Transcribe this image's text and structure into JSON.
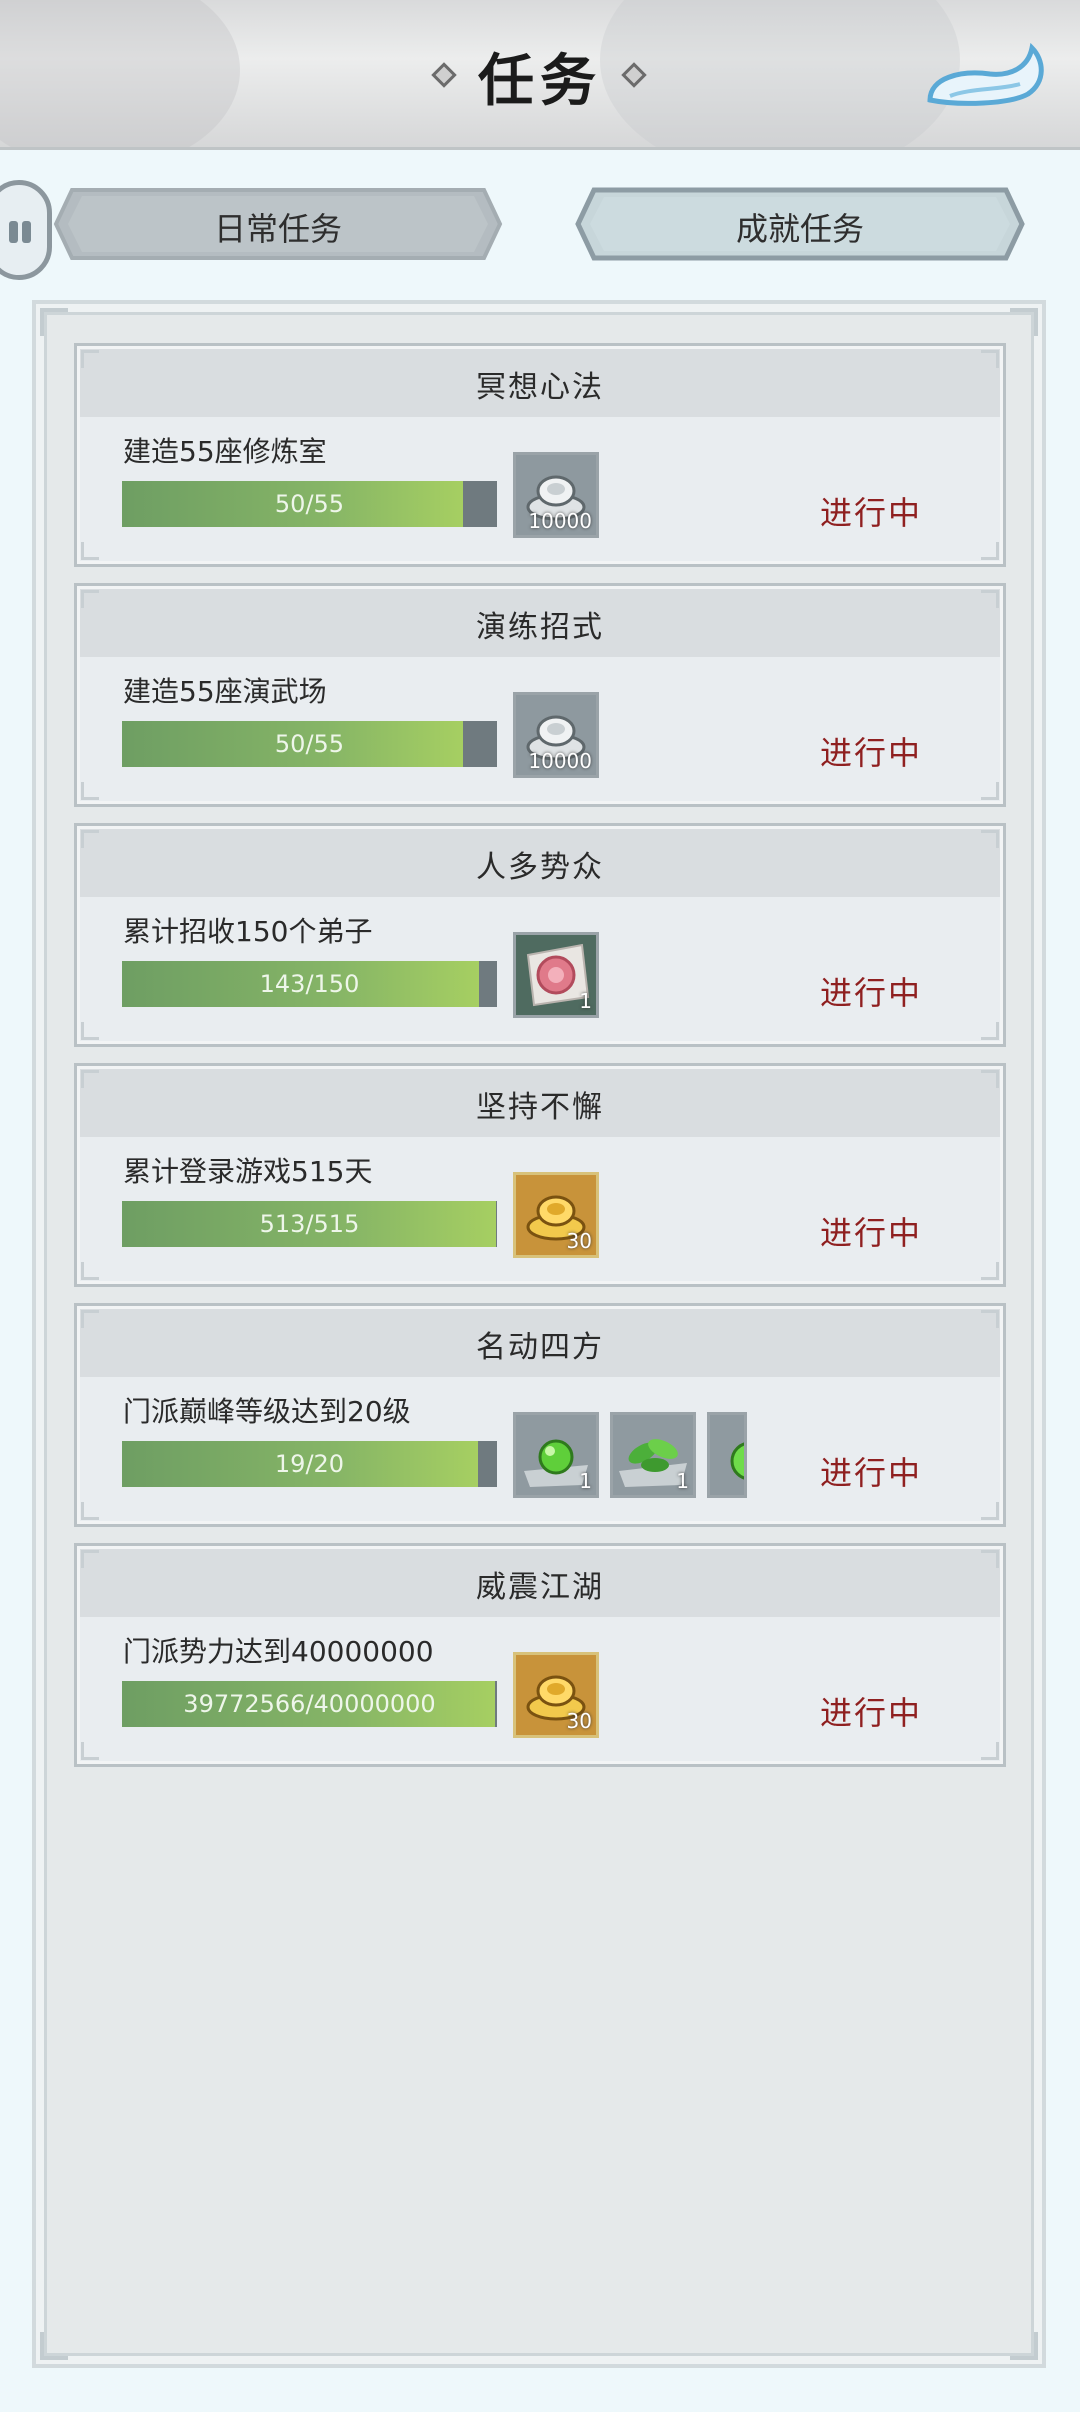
{
  "header": {
    "title": "任务"
  },
  "tabs": [
    {
      "label": "日常任务",
      "active": false
    },
    {
      "label": "成就任务",
      "active": true
    }
  ],
  "tasks": [
    {
      "title": "冥想心法",
      "desc": "建造55座修炼室",
      "progress_text": "50/55",
      "progress": 0.909,
      "rewards": [
        {
          "icon": "silver-ingot-icon",
          "count": "10000"
        }
      ],
      "status": "进行中"
    },
    {
      "title": "演练招式",
      "desc": "建造55座演武场",
      "progress_text": "50/55",
      "progress": 0.909,
      "rewards": [
        {
          "icon": "silver-ingot-icon",
          "count": "10000"
        }
      ],
      "status": "进行中"
    },
    {
      "title": "人多势众",
      "desc": "累计招收150个弟子",
      "progress_text": "143/150",
      "progress": 0.953,
      "rewards": [
        {
          "icon": "recruit-token-icon",
          "count": "1"
        }
      ],
      "status": "进行中"
    },
    {
      "title": "坚持不懈",
      "desc": "累计登录游戏515天",
      "progress_text": "513/515",
      "progress": 0.996,
      "rewards": [
        {
          "icon": "gold-ingot-icon",
          "count": "30"
        }
      ],
      "status": "进行中"
    },
    {
      "title": "名动四方",
      "desc": "门派巅峰等级达到20级",
      "progress_text": "19/20",
      "progress": 0.95,
      "rewards": [
        {
          "icon": "green-pill-icon",
          "count": "1"
        },
        {
          "icon": "herb-leaves-icon",
          "count": "1"
        },
        {
          "icon": "green-potion-icon",
          "count": ""
        }
      ],
      "status": "进行中"
    },
    {
      "title": "威震江湖",
      "desc": "门派势力达到40000000",
      "progress_text": "39772566/40000000",
      "progress": 0.994,
      "rewards": [
        {
          "icon": "gold-ingot-icon",
          "count": "30"
        }
      ],
      "status": "进行中"
    }
  ]
}
